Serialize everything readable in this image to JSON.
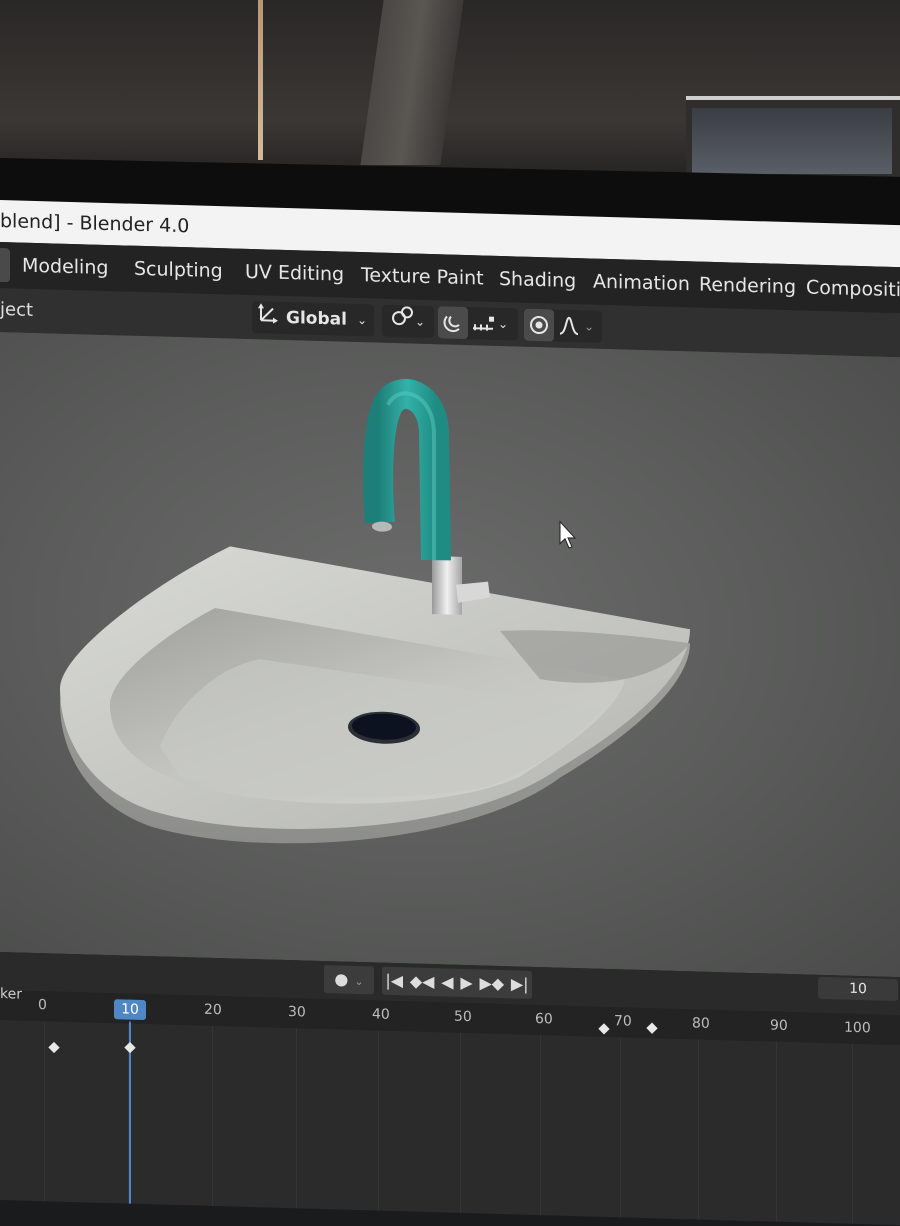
{
  "window": {
    "title": "blend] - Blender 4.0"
  },
  "menubar": {
    "tabs": [
      {
        "label": "Modeling"
      },
      {
        "label": "Sculpting"
      },
      {
        "label": "UV Editing"
      },
      {
        "label": "Texture Paint"
      },
      {
        "label": "Shading"
      },
      {
        "label": "Animation"
      },
      {
        "label": "Rendering"
      },
      {
        "label": "Compositing"
      }
    ]
  },
  "header": {
    "mode_label": "ject",
    "transform_orientation": "Global",
    "icons": [
      "transform-gizmo-icon",
      "pivot-link-icon",
      "snap-magnet-icon",
      "snap-increment-icon",
      "proportional-edit-icon",
      "falloff-curve-icon"
    ]
  },
  "viewport": {
    "object_colors": {
      "faucet_spout": "#2aa39a",
      "sink": "#c9cac6",
      "drain": "#0d1220"
    }
  },
  "timeline": {
    "header_label": "ker",
    "current_frame": "10",
    "end_frame_field": "10",
    "ruler_ticks": [
      "0",
      "10",
      "20",
      "30",
      "40",
      "50",
      "60",
      "70",
      "80",
      "90",
      "100"
    ],
    "keyframes": [
      0,
      10,
      70,
      76
    ],
    "playback_icons": [
      "record-icon",
      "jump-start-icon",
      "prev-keyframe-icon",
      "play-reverse-icon",
      "play-icon",
      "next-keyframe-icon",
      "jump-end-icon"
    ]
  },
  "colors": {
    "accent": "#4f86c6",
    "ui_bg": "#303030"
  }
}
